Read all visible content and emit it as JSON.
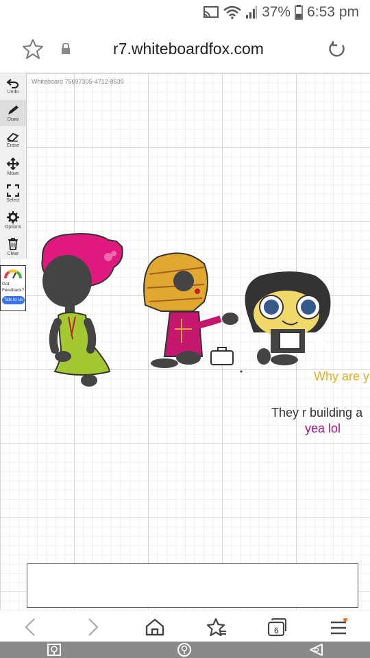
{
  "status_bar": {
    "battery": "37%",
    "time": "6:53 pm"
  },
  "browser": {
    "url": "r7.whiteboardfox.com",
    "tab_count": "6"
  },
  "whiteboard": {
    "id_label": "Whiteboard 75697305-4712-8539",
    "tools": [
      {
        "label": "Undo",
        "icon": "undo-icon"
      },
      {
        "label": "Draw",
        "icon": "pencil-icon"
      },
      {
        "label": "Erase",
        "icon": "eraser-icon"
      },
      {
        "label": "Move",
        "icon": "move-icon"
      },
      {
        "label": "Select",
        "icon": "select-icon"
      },
      {
        "label": "Options",
        "icon": "gear-icon"
      },
      {
        "label": "Clear",
        "icon": "trash-icon"
      }
    ],
    "feedback": {
      "line1": "Got",
      "line2": "Feedback?",
      "button": "Talk to us"
    },
    "messages": [
      {
        "text": "Why are y",
        "color": "#e0b020"
      },
      {
        "text": "They r building a",
        "color": "#333333"
      },
      {
        "text": "yea lol",
        "color": "#b0107a"
      }
    ]
  }
}
